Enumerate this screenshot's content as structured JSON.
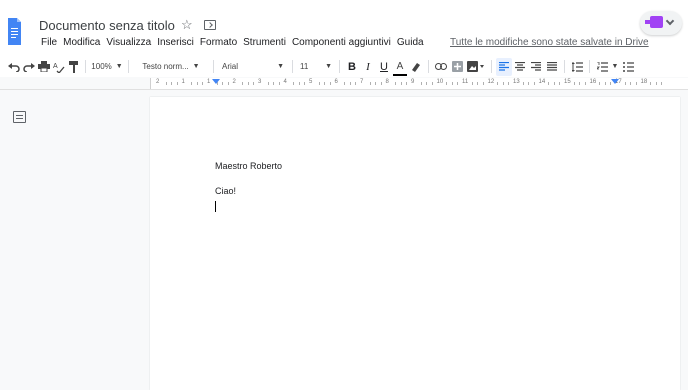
{
  "document": {
    "title": "Documento senza titolo",
    "body_lines": [
      "Maestro Roberto",
      "Ciao!"
    ]
  },
  "menu": [
    "File",
    "Modifica",
    "Visualizza",
    "Inserisci",
    "Formato",
    "Strumenti",
    "Componenti aggiuntivi",
    "Guida"
  ],
  "save_status": "Tutte le modifiche sono state salvate in Drive",
  "toolbar": {
    "zoom": "100%",
    "style": "Testo norm...",
    "font": "Arial",
    "font_size": "11",
    "bold": "B",
    "italic": "I",
    "underline": "U",
    "text_color": "A"
  },
  "ruler": {
    "labels": [
      "2",
      "1",
      "1",
      "2",
      "3",
      "4",
      "5",
      "6",
      "7",
      "8",
      "9",
      "10",
      "11",
      "12",
      "13",
      "14",
      "15",
      "16",
      "17",
      "18"
    ]
  },
  "icons": {
    "docs": "docs-icon",
    "star": "star-icon",
    "folder": "move-to-folder-icon",
    "addon": "addon-icon",
    "undo": "undo-icon",
    "redo": "redo-icon",
    "print": "print-icon",
    "spellcheck": "spellcheck-icon",
    "paint_format": "paint-format-icon",
    "outline": "document-outline-icon"
  },
  "colors": {
    "accent": "#1a73e8",
    "docs_blue": "#4285f4",
    "addon_purple": "#a142f4"
  }
}
